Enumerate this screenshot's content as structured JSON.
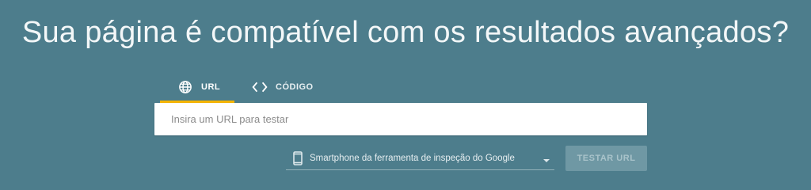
{
  "header": {
    "title": "Sua página é compatível com os resultados avançados?"
  },
  "tabs": [
    {
      "label": "URL",
      "icon": "globe-icon",
      "active": true
    },
    {
      "label": "CÓDIGO",
      "icon": "code-icon",
      "active": false
    }
  ],
  "url_input": {
    "placeholder": "Insira um URL para testar",
    "value": ""
  },
  "device_select": {
    "icon": "smartphone-icon",
    "selected": "Smartphone da ferramenta de inspeção do Google"
  },
  "test_button": {
    "label": "TESTAR URL",
    "enabled": false
  },
  "colors": {
    "background": "#4d7d8c",
    "tab_indicator": "#f5b400",
    "button_disabled_bg": "#6f98a4",
    "button_disabled_text": "#a9c3ca"
  }
}
